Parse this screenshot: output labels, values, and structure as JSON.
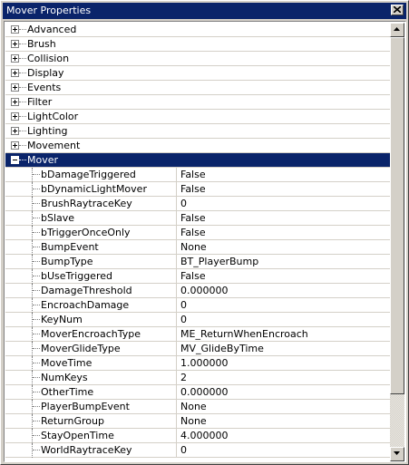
{
  "window": {
    "title": "Mover Properties"
  },
  "categories_top": [
    {
      "label": "Advanced"
    },
    {
      "label": "Brush"
    },
    {
      "label": "Collision"
    },
    {
      "label": "Display"
    },
    {
      "label": "Events"
    },
    {
      "label": "Filter"
    },
    {
      "label": "LightColor"
    },
    {
      "label": "Lighting"
    },
    {
      "label": "Movement"
    }
  ],
  "expanded_category": {
    "label": "Mover"
  },
  "properties": [
    {
      "name": "bDamageTriggered",
      "value": "False"
    },
    {
      "name": "bDynamicLightMover",
      "value": "False"
    },
    {
      "name": "BrushRaytraceKey",
      "value": "0"
    },
    {
      "name": "bSlave",
      "value": "False"
    },
    {
      "name": "bTriggerOnceOnly",
      "value": "False"
    },
    {
      "name": "BumpEvent",
      "value": "None"
    },
    {
      "name": "BumpType",
      "value": "BT_PlayerBump"
    },
    {
      "name": "bUseTriggered",
      "value": "False"
    },
    {
      "name": "DamageThreshold",
      "value": "0.000000"
    },
    {
      "name": "EncroachDamage",
      "value": "0"
    },
    {
      "name": "KeyNum",
      "value": "0"
    },
    {
      "name": "MoverEncroachType",
      "value": "ME_ReturnWhenEncroach"
    },
    {
      "name": "MoverGlideType",
      "value": "MV_GlideByTime"
    },
    {
      "name": "MoveTime",
      "value": "1.000000"
    },
    {
      "name": "NumKeys",
      "value": "2"
    },
    {
      "name": "OtherTime",
      "value": "0.000000"
    },
    {
      "name": "PlayerBumpEvent",
      "value": "None"
    },
    {
      "name": "ReturnGroup",
      "value": "None"
    },
    {
      "name": "StayOpenTime",
      "value": "4.000000"
    },
    {
      "name": "WorldRaytraceKey",
      "value": "0"
    }
  ],
  "colors": {
    "selection": "#0a246a",
    "face": "#d4d0c8"
  }
}
